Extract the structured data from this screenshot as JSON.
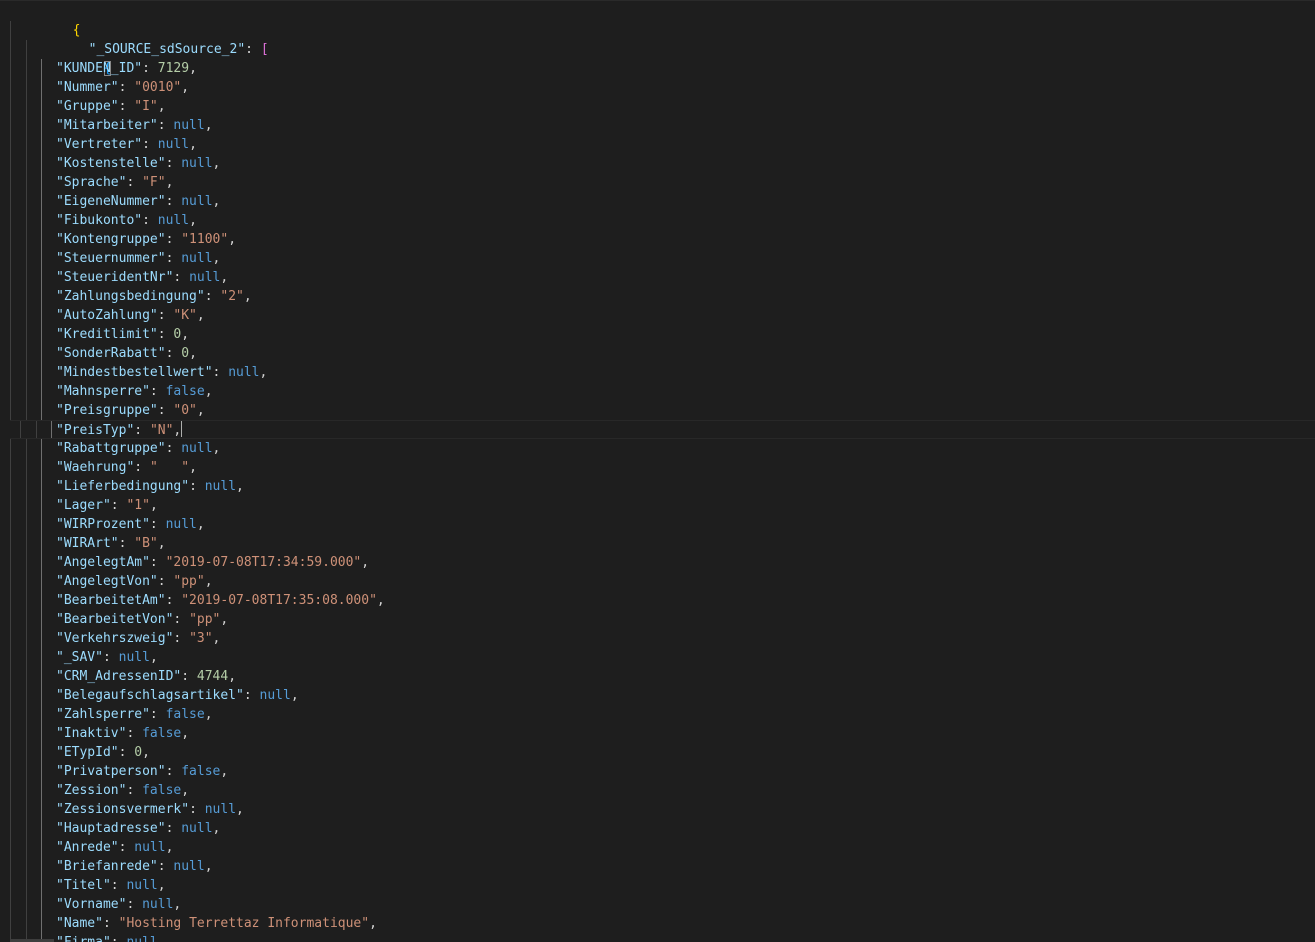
{
  "editor": {
    "open_brace": "{",
    "root_key": "\"_SOURCE_sdSource_2\"",
    "open_bracket": "[",
    "object_open": "{",
    "colon": ": ",
    "comma": ",",
    "caret_line_key": "\"PreisTyp\"",
    "entries": [
      {
        "key": "\"KUNDEN_ID\"",
        "value": "7129",
        "type": "number"
      },
      {
        "key": "\"Nummer\"",
        "value": "\"0010\"",
        "type": "string"
      },
      {
        "key": "\"Gruppe\"",
        "value": "\"I\"",
        "type": "string"
      },
      {
        "key": "\"Mitarbeiter\"",
        "value": "null",
        "type": "literal"
      },
      {
        "key": "\"Vertreter\"",
        "value": "null",
        "type": "literal"
      },
      {
        "key": "\"Kostenstelle\"",
        "value": "null",
        "type": "literal"
      },
      {
        "key": "\"Sprache\"",
        "value": "\"F\"",
        "type": "string"
      },
      {
        "key": "\"EigeneNummer\"",
        "value": "null",
        "type": "literal"
      },
      {
        "key": "\"Fibukonto\"",
        "value": "null",
        "type": "literal"
      },
      {
        "key": "\"Kontengruppe\"",
        "value": "\"1100\"",
        "type": "string"
      },
      {
        "key": "\"Steuernummer\"",
        "value": "null",
        "type": "literal"
      },
      {
        "key": "\"SteueridentNr\"",
        "value": "null",
        "type": "literal"
      },
      {
        "key": "\"Zahlungsbedingung\"",
        "value": "\"2\"",
        "type": "string"
      },
      {
        "key": "\"AutoZahlung\"",
        "value": "\"K\"",
        "type": "string"
      },
      {
        "key": "\"Kreditlimit\"",
        "value": "0",
        "type": "number"
      },
      {
        "key": "\"SonderRabatt\"",
        "value": "0",
        "type": "number"
      },
      {
        "key": "\"Mindestbestellwert\"",
        "value": "null",
        "type": "literal"
      },
      {
        "key": "\"Mahnsperre\"",
        "value": "false",
        "type": "literal"
      },
      {
        "key": "\"Preisgruppe\"",
        "value": "\"0\"",
        "type": "string"
      },
      {
        "key": "\"PreisTyp\"",
        "value": "\"N\"",
        "type": "string"
      },
      {
        "key": "\"Rabattgruppe\"",
        "value": "null",
        "type": "literal"
      },
      {
        "key": "\"Waehrung\"",
        "value": "\"   \"",
        "type": "string"
      },
      {
        "key": "\"Lieferbedingung\"",
        "value": "null",
        "type": "literal"
      },
      {
        "key": "\"Lager\"",
        "value": "\"1\"",
        "type": "string"
      },
      {
        "key": "\"WIRProzent\"",
        "value": "null",
        "type": "literal"
      },
      {
        "key": "\"WIRArt\"",
        "value": "\"B\"",
        "type": "string"
      },
      {
        "key": "\"AngelegtAm\"",
        "value": "\"2019-07-08T17:34:59.000\"",
        "type": "string"
      },
      {
        "key": "\"AngelegtVon\"",
        "value": "\"pp\"",
        "type": "string"
      },
      {
        "key": "\"BearbeitetAm\"",
        "value": "\"2019-07-08T17:35:08.000\"",
        "type": "string"
      },
      {
        "key": "\"BearbeitetVon\"",
        "value": "\"pp\"",
        "type": "string"
      },
      {
        "key": "\"Verkehrszweig\"",
        "value": "\"3\"",
        "type": "string"
      },
      {
        "key": "\"_SAV\"",
        "value": "null",
        "type": "literal"
      },
      {
        "key": "\"CRM_AdressenID\"",
        "value": "4744",
        "type": "number"
      },
      {
        "key": "\"Belegaufschlagsartikel\"",
        "value": "null",
        "type": "literal"
      },
      {
        "key": "\"Zahlsperre\"",
        "value": "false",
        "type": "literal"
      },
      {
        "key": "\"Inaktiv\"",
        "value": "false",
        "type": "literal"
      },
      {
        "key": "\"ETypId\"",
        "value": "0",
        "type": "number"
      },
      {
        "key": "\"Privatperson\"",
        "value": "false",
        "type": "literal"
      },
      {
        "key": "\"Zession\"",
        "value": "false",
        "type": "literal"
      },
      {
        "key": "\"Zessionsvermerk\"",
        "value": "null",
        "type": "literal"
      },
      {
        "key": "\"Hauptadresse\"",
        "value": "null",
        "type": "literal"
      },
      {
        "key": "\"Anrede\"",
        "value": "null",
        "type": "literal"
      },
      {
        "key": "\"Briefanrede\"",
        "value": "null",
        "type": "literal"
      },
      {
        "key": "\"Titel\"",
        "value": "null",
        "type": "literal"
      },
      {
        "key": "\"Vorname\"",
        "value": "null",
        "type": "literal"
      },
      {
        "key": "\"Name\"",
        "value": "\"Hosting Terrettaz Informatique\"",
        "type": "string"
      },
      {
        "key": "\"Firma\"",
        "value": "null",
        "type": "literal"
      }
    ]
  },
  "colors": {
    "background": "#1e1e1e",
    "key": "#9cdcfe",
    "string": "#ce9178",
    "number": "#b5cea8",
    "literal": "#569cd6",
    "brace_level_1": "#ffd700",
    "bracket_level_2": "#da70d6",
    "brace_level_3": "#179fff"
  }
}
